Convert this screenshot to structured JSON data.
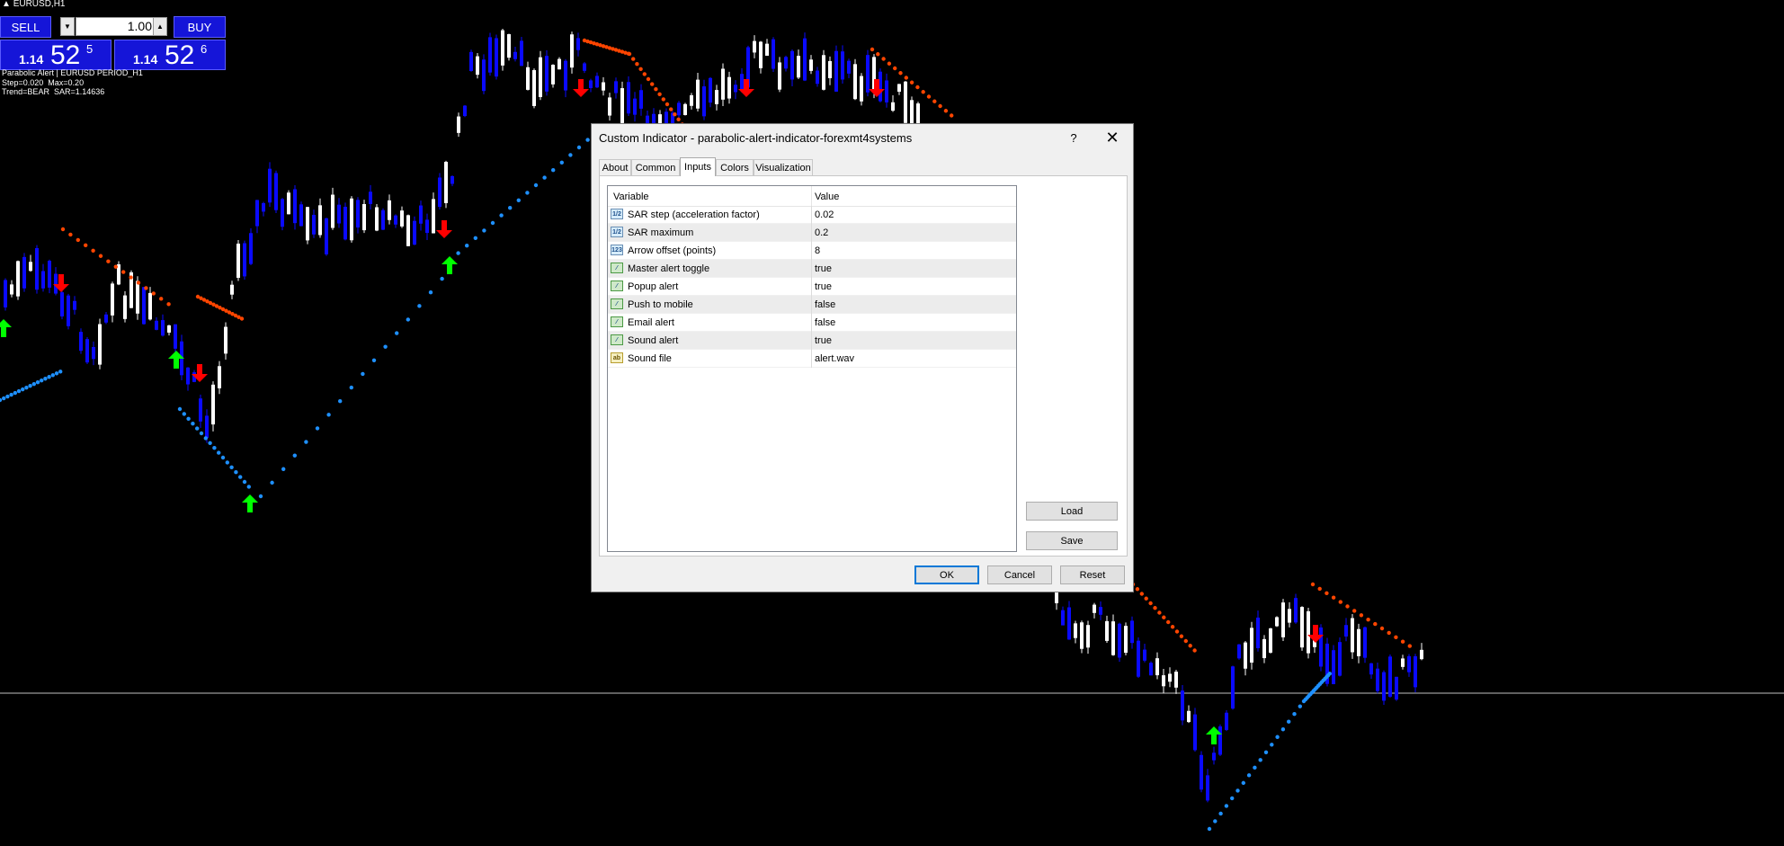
{
  "chart": {
    "symbol_title": "EURUSD,H1",
    "indicator_info": [
      "Parabolic Alert | EURUSD PERIOD_H1",
      "Step=0.020  Max=0.20",
      "Trend=BEAR  SAR=1.14636"
    ],
    "colors": {
      "background": "#000000",
      "bull_candle": "#ffffff",
      "bear_candle": "#0a0aff",
      "sar_bull": "#1e90ff",
      "sar_bear": "#ff4500",
      "arrow_up": "#00ff00",
      "arrow_down": "#ff0000",
      "price_line": "#c0c0c0"
    }
  },
  "trade_panel": {
    "sell_label": "SELL",
    "buy_label": "BUY",
    "lot_value": "1.00",
    "down_icon": "triangle-down",
    "up_icon": "triangle-up",
    "bid": {
      "prefix": "1.14",
      "big": "52",
      "sup": "5"
    },
    "ask": {
      "prefix": "1.14",
      "big": "52",
      "sup": "6"
    }
  },
  "dialog": {
    "title": "Custom Indicator - parabolic-alert-indicator-forexmt4systems",
    "help": "?",
    "close": "✕",
    "tabs": [
      "About",
      "Common",
      "Inputs",
      "Colors",
      "Visualization"
    ],
    "active_tab": "Inputs",
    "columns": {
      "variable": "Variable",
      "value": "Value"
    },
    "inputs": [
      {
        "icon": "1/2",
        "type": "double",
        "variable": "SAR step (acceleration factor)",
        "value": "0.02"
      },
      {
        "icon": "1/2",
        "type": "double",
        "variable": "SAR maximum",
        "value": "0.2"
      },
      {
        "icon": "123",
        "type": "int",
        "variable": "Arrow offset (points)",
        "value": "8"
      },
      {
        "icon": "bool",
        "type": "bool",
        "variable": "Master alert toggle",
        "value": "true"
      },
      {
        "icon": "bool",
        "type": "bool",
        "variable": "Popup alert",
        "value": "true"
      },
      {
        "icon": "bool",
        "type": "bool",
        "variable": "Push to mobile",
        "value": "false"
      },
      {
        "icon": "bool",
        "type": "bool",
        "variable": "Email alert",
        "value": "false"
      },
      {
        "icon": "bool",
        "type": "bool",
        "variable": "Sound alert",
        "value": "true"
      },
      {
        "icon": "ab",
        "type": "string",
        "variable": "Sound file",
        "value": "alert.wav"
      }
    ],
    "load_label": "Load",
    "save_label": "Save",
    "ok_label": "OK",
    "cancel_label": "Cancel",
    "reset_label": "Reset"
  }
}
